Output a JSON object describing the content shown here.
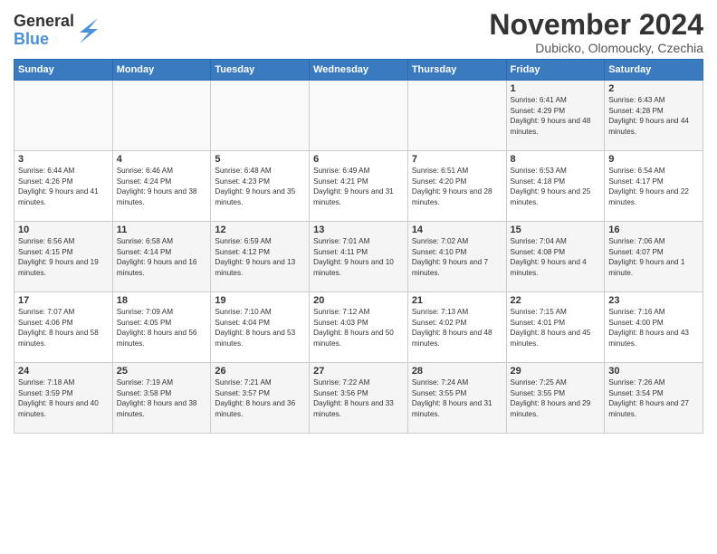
{
  "logo": {
    "general": "General",
    "blue": "Blue"
  },
  "title": "November 2024",
  "location": "Dubicko, Olomoucky, Czechia",
  "days_of_week": [
    "Sunday",
    "Monday",
    "Tuesday",
    "Wednesday",
    "Thursday",
    "Friday",
    "Saturday"
  ],
  "weeks": [
    [
      {
        "day": "",
        "info": ""
      },
      {
        "day": "",
        "info": ""
      },
      {
        "day": "",
        "info": ""
      },
      {
        "day": "",
        "info": ""
      },
      {
        "day": "",
        "info": ""
      },
      {
        "day": "1",
        "info": "Sunrise: 6:41 AM\nSunset: 4:29 PM\nDaylight: 9 hours and 48 minutes."
      },
      {
        "day": "2",
        "info": "Sunrise: 6:43 AM\nSunset: 4:28 PM\nDaylight: 9 hours and 44 minutes."
      }
    ],
    [
      {
        "day": "3",
        "info": "Sunrise: 6:44 AM\nSunset: 4:26 PM\nDaylight: 9 hours and 41 minutes."
      },
      {
        "day": "4",
        "info": "Sunrise: 6:46 AM\nSunset: 4:24 PM\nDaylight: 9 hours and 38 minutes."
      },
      {
        "day": "5",
        "info": "Sunrise: 6:48 AM\nSunset: 4:23 PM\nDaylight: 9 hours and 35 minutes."
      },
      {
        "day": "6",
        "info": "Sunrise: 6:49 AM\nSunset: 4:21 PM\nDaylight: 9 hours and 31 minutes."
      },
      {
        "day": "7",
        "info": "Sunrise: 6:51 AM\nSunset: 4:20 PM\nDaylight: 9 hours and 28 minutes."
      },
      {
        "day": "8",
        "info": "Sunrise: 6:53 AM\nSunset: 4:18 PM\nDaylight: 9 hours and 25 minutes."
      },
      {
        "day": "9",
        "info": "Sunrise: 6:54 AM\nSunset: 4:17 PM\nDaylight: 9 hours and 22 minutes."
      }
    ],
    [
      {
        "day": "10",
        "info": "Sunrise: 6:56 AM\nSunset: 4:15 PM\nDaylight: 9 hours and 19 minutes."
      },
      {
        "day": "11",
        "info": "Sunrise: 6:58 AM\nSunset: 4:14 PM\nDaylight: 9 hours and 16 minutes."
      },
      {
        "day": "12",
        "info": "Sunrise: 6:59 AM\nSunset: 4:12 PM\nDaylight: 9 hours and 13 minutes."
      },
      {
        "day": "13",
        "info": "Sunrise: 7:01 AM\nSunset: 4:11 PM\nDaylight: 9 hours and 10 minutes."
      },
      {
        "day": "14",
        "info": "Sunrise: 7:02 AM\nSunset: 4:10 PM\nDaylight: 9 hours and 7 minutes."
      },
      {
        "day": "15",
        "info": "Sunrise: 7:04 AM\nSunset: 4:08 PM\nDaylight: 9 hours and 4 minutes."
      },
      {
        "day": "16",
        "info": "Sunrise: 7:06 AM\nSunset: 4:07 PM\nDaylight: 9 hours and 1 minute."
      }
    ],
    [
      {
        "day": "17",
        "info": "Sunrise: 7:07 AM\nSunset: 4:06 PM\nDaylight: 8 hours and 58 minutes."
      },
      {
        "day": "18",
        "info": "Sunrise: 7:09 AM\nSunset: 4:05 PM\nDaylight: 8 hours and 56 minutes."
      },
      {
        "day": "19",
        "info": "Sunrise: 7:10 AM\nSunset: 4:04 PM\nDaylight: 8 hours and 53 minutes."
      },
      {
        "day": "20",
        "info": "Sunrise: 7:12 AM\nSunset: 4:03 PM\nDaylight: 8 hours and 50 minutes."
      },
      {
        "day": "21",
        "info": "Sunrise: 7:13 AM\nSunset: 4:02 PM\nDaylight: 8 hours and 48 minutes."
      },
      {
        "day": "22",
        "info": "Sunrise: 7:15 AM\nSunset: 4:01 PM\nDaylight: 8 hours and 45 minutes."
      },
      {
        "day": "23",
        "info": "Sunrise: 7:16 AM\nSunset: 4:00 PM\nDaylight: 8 hours and 43 minutes."
      }
    ],
    [
      {
        "day": "24",
        "info": "Sunrise: 7:18 AM\nSunset: 3:59 PM\nDaylight: 8 hours and 40 minutes."
      },
      {
        "day": "25",
        "info": "Sunrise: 7:19 AM\nSunset: 3:58 PM\nDaylight: 8 hours and 38 minutes."
      },
      {
        "day": "26",
        "info": "Sunrise: 7:21 AM\nSunset: 3:57 PM\nDaylight: 8 hours and 36 minutes."
      },
      {
        "day": "27",
        "info": "Sunrise: 7:22 AM\nSunset: 3:56 PM\nDaylight: 8 hours and 33 minutes."
      },
      {
        "day": "28",
        "info": "Sunrise: 7:24 AM\nSunset: 3:55 PM\nDaylight: 8 hours and 31 minutes."
      },
      {
        "day": "29",
        "info": "Sunrise: 7:25 AM\nSunset: 3:55 PM\nDaylight: 8 hours and 29 minutes."
      },
      {
        "day": "30",
        "info": "Sunrise: 7:26 AM\nSunset: 3:54 PM\nDaylight: 8 hours and 27 minutes."
      }
    ]
  ]
}
